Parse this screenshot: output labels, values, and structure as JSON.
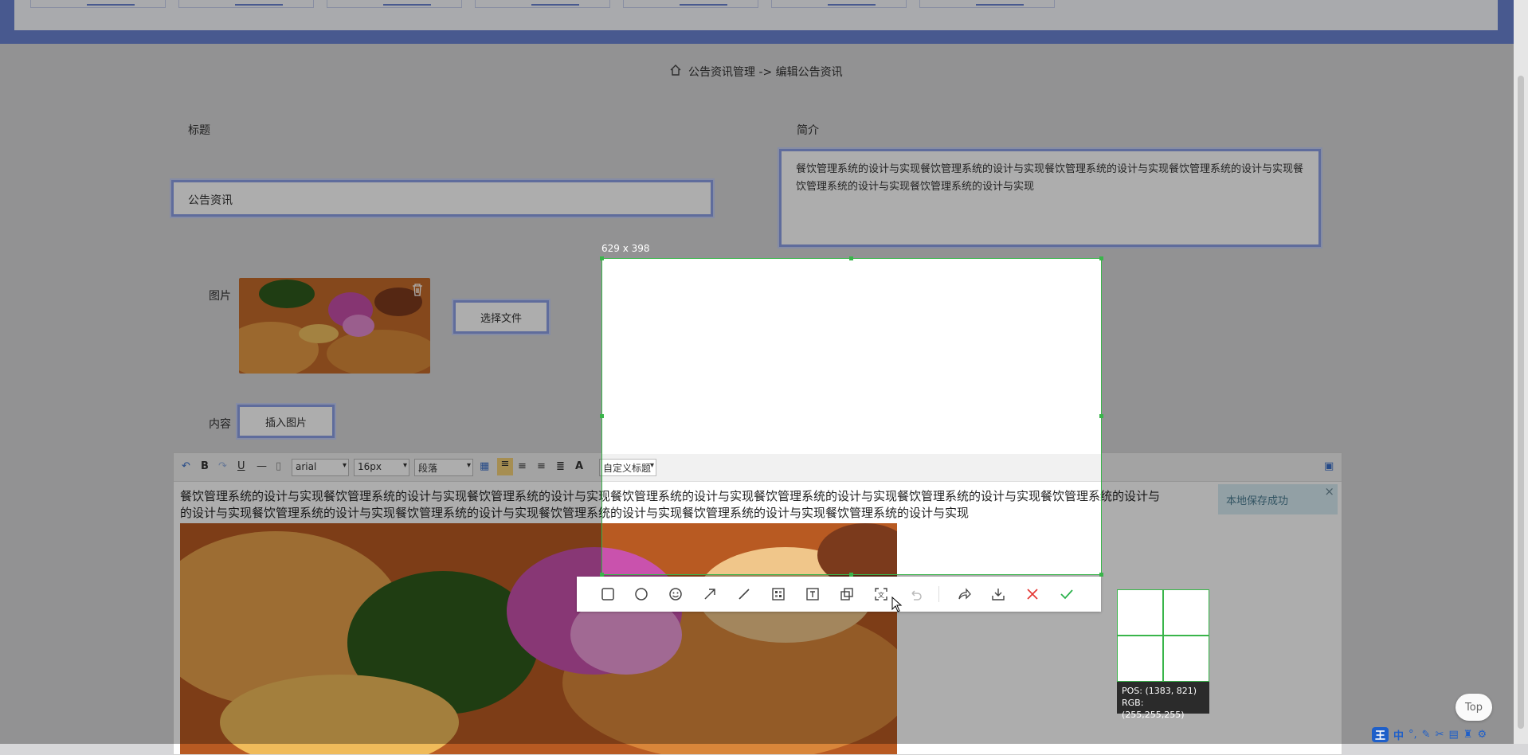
{
  "breadcrumb": {
    "text": "公告资讯管理 -> 编辑公告资讯"
  },
  "form": {
    "title_label": "标题",
    "title_value": "公告资讯",
    "summary_label": "简介",
    "summary_value": "餐饮管理系统的设计与实现餐饮管理系统的设计与实现餐饮管理系统的设计与实现餐饮管理系统的设计与实现餐饮管理系统的设计与实现餐饮管理系统的设计与实现",
    "image_label": "图片",
    "choose_file_button": "选择文件",
    "content_label": "内容",
    "insert_image_button": "插入图片"
  },
  "editor_toolbar": {
    "font_family": "arial",
    "font_size": "16px",
    "paragraph": "段落",
    "custom_heading": "自定义标题",
    "bold": "B",
    "underline": "U",
    "font_color": "A"
  },
  "editor_content": {
    "line1": "餐饮管理系统的设计与实现餐饮管理系统的设计与实现餐饮管理系统的设计与实现餐饮管理系统的设计与实现餐饮管理系统的设计与实现餐饮管理系统的设计与实现餐饮管理系统的设计与",
    "line2": "的设计与实现餐饮管理系统的设计与实现餐饮管理系统的设计与实现餐饮管理系统的设计与实现餐饮管理系统的设计与实现餐饮管理系统的设计与实现"
  },
  "toast": {
    "text": "本地保存成功",
    "close": "×"
  },
  "capture": {
    "size_label": "629 x 398",
    "tools": [
      "rectangle-icon",
      "ellipse-icon",
      "emoji-icon",
      "arrow-icon",
      "line-icon",
      "mosaic-icon",
      "text-icon",
      "pin-icon",
      "ocr-icon",
      "undo-icon",
      "share-icon",
      "download-icon",
      "cancel-icon",
      "confirm-icon"
    ],
    "pos_text": "POS: (1383, 821)",
    "rgb_text": "RGB: (255,255,255)"
  },
  "top_button": "Top",
  "ime": {
    "logo": "王",
    "mode": "中"
  }
}
